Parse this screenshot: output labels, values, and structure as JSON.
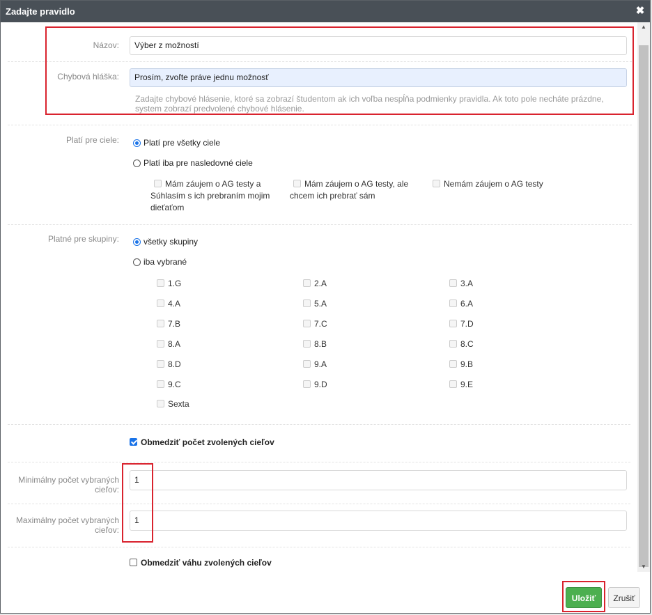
{
  "dialog": {
    "title": "Zadajte pravidlo"
  },
  "name_field": {
    "label": "Názov:",
    "value": "Výber z možností"
  },
  "error_field": {
    "label": "Chybová hláška:",
    "value": "Prosím, zvoľte práve jednu možnosť",
    "help": "Zadajte chybové hlásenie, ktoré sa zobrazí študentom ak ich voľba nespĺňa podmienky pravidla. Ak toto pole necháte prázdne, system zobrazí predvolené chybové hlásenie."
  },
  "targets": {
    "label": "Platí pre ciele:",
    "option_all": "Platí pre všetky ciele",
    "option_selected": "Platí iba pre nasledovné ciele",
    "items": [
      "Mám záujem o AG testy a Súhlasím s ich prebraním mojim dieťaťom",
      "Mám záujem o AG testy, ale chcem ich prebrať sám",
      "Nemám záujem o AG testy"
    ]
  },
  "groups": {
    "label": "Platné pre skupiny:",
    "option_all": "všetky skupiny",
    "option_selected": "iba vybrané",
    "items": [
      "1.G",
      "2.A",
      "3.A",
      "4.A",
      "5.A",
      "6.A",
      "7.B",
      "7.C",
      "7.D",
      "8.A",
      "8.B",
      "8.C",
      "8.D",
      "9.A",
      "9.B",
      "9.C",
      "9.D",
      "9.E",
      "Sexta"
    ]
  },
  "limit_count": {
    "label": "Obmedziť počet zvolených cieľov",
    "checked": true
  },
  "min_field": {
    "label": "Minimálny počet vybraných cieľov:",
    "value": "1"
  },
  "max_field": {
    "label": "Maximálny počet vybraných cieľov:",
    "value": "1"
  },
  "limit_weight": {
    "label": "Obmedziť váhu zvolených cieľov",
    "checked": false
  },
  "buttons": {
    "save": "Uložiť",
    "cancel": "Zrušiť"
  },
  "colors": {
    "titlebar": "#495057",
    "save": "#4caf50",
    "highlight": "#d9232e",
    "radio_accent": "#1a73e8"
  }
}
